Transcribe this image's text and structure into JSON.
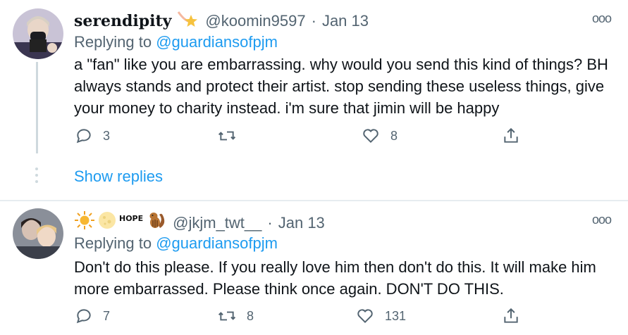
{
  "tweets": [
    {
      "display_name": "serendipity",
      "handle": "@koomin9597",
      "date": "Jan 13",
      "replying_prefix": "Replying to",
      "replying_to": "@guardiansofpjm",
      "text": "a \"fan\" like you are embarrassing. why would you send this kind of things? BH always stands and protect their artist. stop sending these useless things, give your money to charity instead. i'm sure that jimin will be happy",
      "reply_count": "3",
      "retweet_count": "",
      "like_count": "8",
      "show_replies": "Show replies"
    },
    {
      "display_name_badge": "HOPE",
      "handle": "@jkjm_twt__",
      "date": "Jan 13",
      "replying_prefix": "Replying to",
      "replying_to": "@guardiansofpjm",
      "text": "Don't do this please. If you really love him then don't do this. It will make him more embarrassed. Please think once again. DON'T DO THIS.",
      "reply_count": "7",
      "retweet_count": "8",
      "like_count": "131"
    }
  ],
  "colors": {
    "link": "#1d9bf0",
    "muted": "#536471",
    "text": "#0f1419"
  }
}
